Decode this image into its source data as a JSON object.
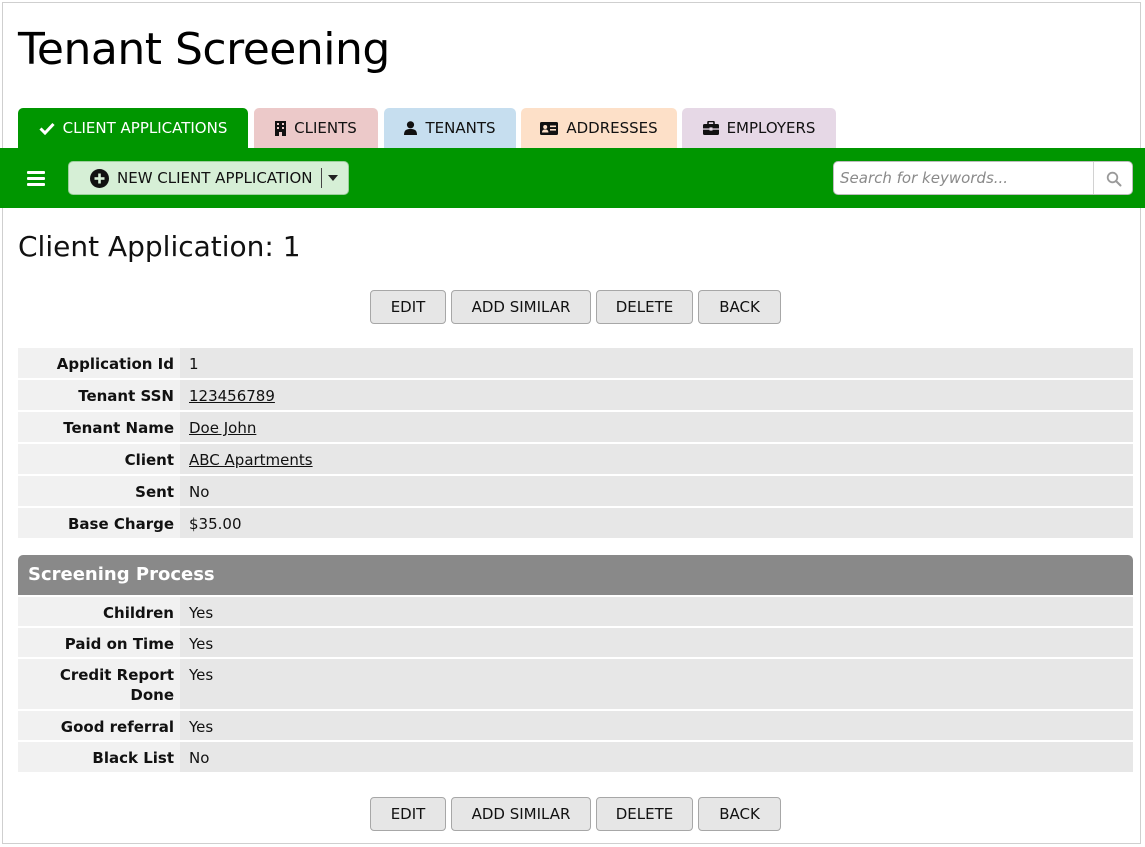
{
  "app": {
    "title": "Tenant Screening"
  },
  "tabs": [
    {
      "label": "CLIENT APPLICATIONS",
      "icon": "checkmark-icon",
      "color": "#009600",
      "active": true
    },
    {
      "label": "CLIENTS",
      "icon": "building-icon",
      "color": "#ecc9c9",
      "active": false
    },
    {
      "label": "TENANTS",
      "icon": "user-icon",
      "color": "#c6deef",
      "active": false
    },
    {
      "label": "ADDRESSES",
      "icon": "address-card-icon",
      "color": "#fde0c8",
      "active": false
    },
    {
      "label": "EMPLOYERS",
      "icon": "briefcase-icon",
      "color": "#e6d8e6",
      "active": false
    }
  ],
  "toolbar": {
    "menu_icon": "hamburger-icon",
    "new_button_label": "NEW CLIENT APPLICATION",
    "search_placeholder": "Search for keywords...",
    "color": "#009600"
  },
  "record": {
    "title": "Client Application: 1"
  },
  "actions": {
    "edit": "EDIT",
    "add_similar": "ADD SIMILAR",
    "delete": "DELETE",
    "back": "BACK"
  },
  "fields": [
    {
      "label": "Application Id",
      "value": "1",
      "link": false
    },
    {
      "label": "Tenant SSN",
      "value": "123456789",
      "link": true
    },
    {
      "label": "Tenant Name",
      "value": "Doe John",
      "link": true
    },
    {
      "label": "Client",
      "value": "ABC Apartments",
      "link": true
    },
    {
      "label": "Sent",
      "value": "No",
      "link": false
    },
    {
      "label": "Base Charge",
      "value": "$35.00",
      "link": false
    }
  ],
  "screening": {
    "title": "Screening Process",
    "fields": [
      {
        "label": "Children",
        "value": "Yes"
      },
      {
        "label": "Paid on Time",
        "value": "Yes"
      },
      {
        "label_line1": "Credit Report",
        "label_line2": "Done",
        "value": "Yes"
      },
      {
        "label": "Good referral",
        "value": "Yes"
      },
      {
        "label": "Black List",
        "value": "No"
      }
    ]
  }
}
